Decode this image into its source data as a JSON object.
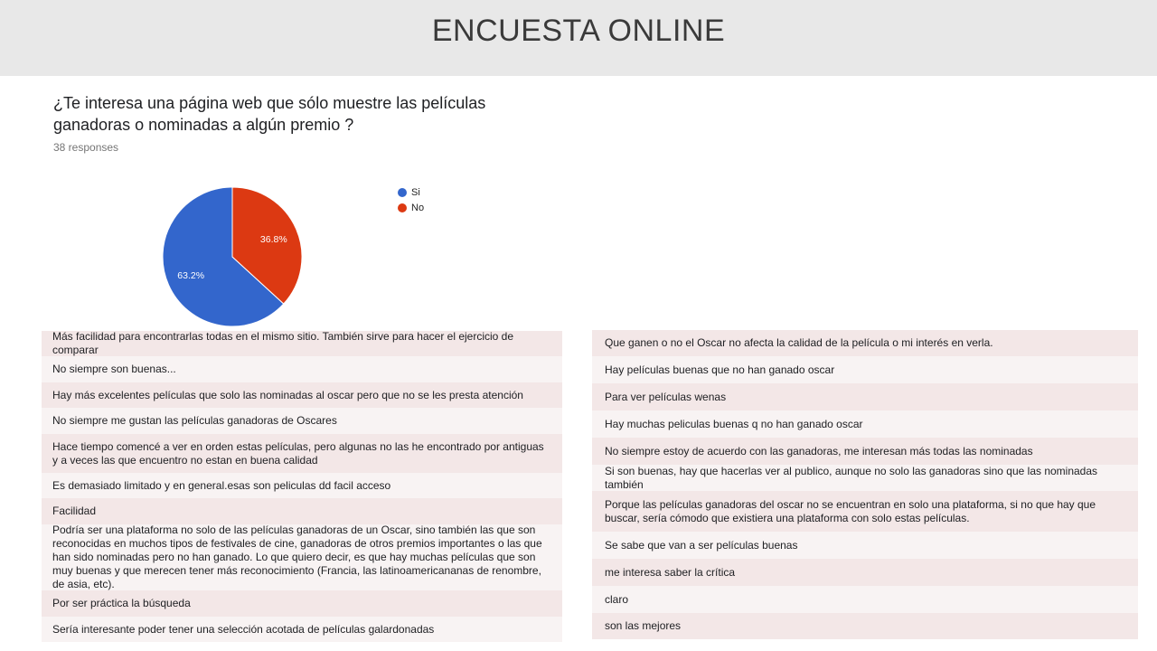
{
  "header": {
    "title": "ENCUESTA ONLINE"
  },
  "question": {
    "title": "¿Te interesa una página web que sólo muestre las películas ganadoras o nominadas a algún premio ?",
    "responses": "38 responses"
  },
  "chart_data": {
    "type": "pie",
    "slices": [
      {
        "label": "Si",
        "value": 63.2,
        "display": "63.2%",
        "color": "#3366cc"
      },
      {
        "label": "No",
        "value": 36.8,
        "display": "36.8%",
        "color": "#dc3912"
      }
    ],
    "legend": "right"
  },
  "answers_left": [
    {
      "text": "Más facilidad para encontrarlas todas en el mismo sitio. También sirve para hacer el ejercicio de comparar"
    },
    {
      "text": "No siempre son buenas..."
    },
    {
      "text": "Hay más excelentes películas que solo las nominadas al oscar pero que no se les presta atención"
    },
    {
      "text": "No siempre me gustan las películas ganadoras de Oscares"
    },
    {
      "text": "Hace tiempo comencé a ver en orden estas películas, pero algunas no las he encontrado por antiguas y a veces las que encuentro no estan en buena calidad"
    },
    {
      "text": "Es demasiado limitado y en general.esas son peliculas dd facil acceso"
    },
    {
      "text": "Facilidad"
    },
    {
      "text": "Podría ser una plataforma no solo de las películas ganadoras de un Oscar, sino también las que son reconocidas en muchos tipos de festivales de cine, ganadoras de otros premios importantes o las que han sido nominadas pero no han ganado. Lo que quiero decir, es que hay muchas películas que son muy buenas y que merecen tener más reconocimiento (Francia, las latinoamericananas de renombre, de asia, etc)."
    },
    {
      "text": "Por ser práctica la búsqueda"
    },
    {
      "text": "Sería interesante poder tener una selección acotada de películas galardonadas"
    }
  ],
  "answers_right": [
    {
      "text": "Que ganen o no el Oscar no afecta la calidad de la película o mi interés en verla."
    },
    {
      "text": "Hay películas buenas que no han ganado oscar"
    },
    {
      "text": "Para ver películas wenas"
    },
    {
      "text": "Hay muchas peliculas buenas q no han ganado oscar"
    },
    {
      "text": "No siempre estoy de acuerdo con las ganadoras, me interesan más todas las nominadas"
    },
    {
      "text": "Si son buenas, hay que hacerlas ver al publico, aunque no solo las ganadoras sino que las nominadas también"
    },
    {
      "text": "Porque las películas ganadoras del oscar no se encuentran en solo una plataforma, si no que hay que buscar, sería cómodo que existiera una plataforma con solo estas películas."
    },
    {
      "text": "Se sabe que van a ser películas buenas"
    },
    {
      "text": "me interesa saber la crítica"
    },
    {
      "text": "claro"
    },
    {
      "text": "son las mejores"
    }
  ]
}
